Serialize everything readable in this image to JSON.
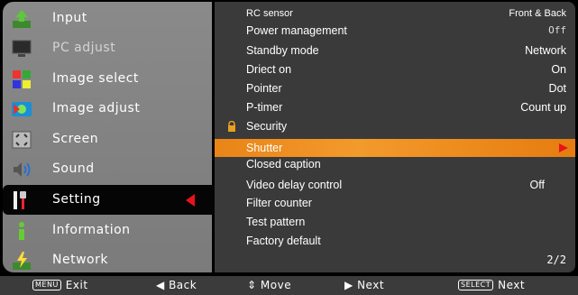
{
  "left_menu": {
    "items": [
      {
        "label": "Input"
      },
      {
        "label": "PC adjust"
      },
      {
        "label": "Image select"
      },
      {
        "label": "Image adjust"
      },
      {
        "label": "Screen"
      },
      {
        "label": "Sound"
      },
      {
        "label": "Setting"
      },
      {
        "label": "Information"
      },
      {
        "label": "Network"
      }
    ],
    "selected": "Setting"
  },
  "settings_panel": {
    "items": [
      {
        "label": "RC sensor",
        "value": "Front & Back"
      },
      {
        "label": "Power management",
        "value": "Off"
      },
      {
        "label": "Standby mode",
        "value": "Network"
      },
      {
        "label": "Driect on",
        "value": "On"
      },
      {
        "label": "Pointer",
        "value": "Dot"
      },
      {
        "label": "P-timer",
        "value": "Count up"
      },
      {
        "label": "Security",
        "value": ""
      },
      {
        "label": "Shutter",
        "value": ""
      },
      {
        "label": "Closed caption",
        "value": ""
      },
      {
        "label": "Video delay control",
        "value": "Off"
      },
      {
        "label": "Filter counter",
        "value": ""
      },
      {
        "label": "Test pattern",
        "value": ""
      },
      {
        "label": "Factory default",
        "value": ""
      }
    ],
    "highlighted": "Shutter",
    "page": "2/2"
  },
  "bottom_bar": {
    "exit_key": "MENU",
    "exit": "Exit",
    "back": "Back",
    "move": "Move",
    "next": "Next",
    "select_key": "SELECT",
    "select_next": "Next"
  },
  "colors": {
    "highlight": "#f39a2c",
    "selected_arrow": "#e8121b",
    "panel_bg": "#3a3a3a",
    "menu_bg": "#8a8a8a"
  }
}
